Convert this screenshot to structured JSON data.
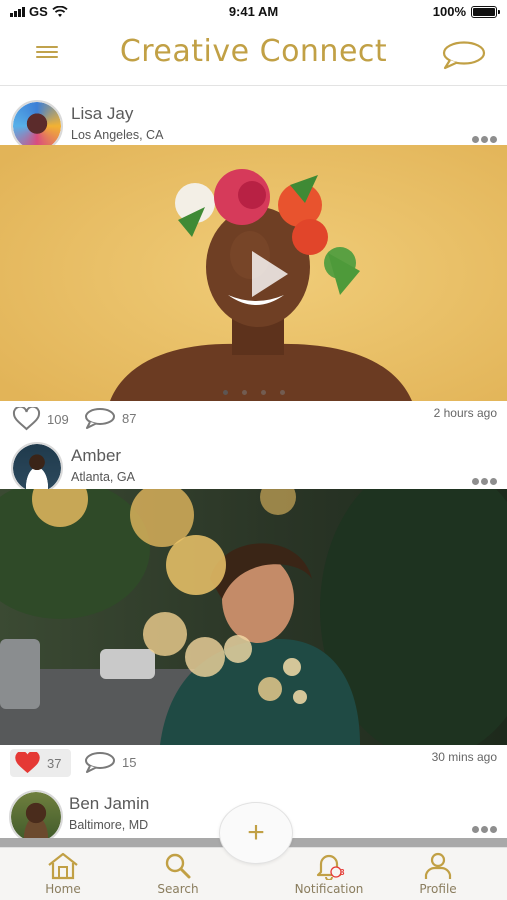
{
  "status_bar": {
    "carrier": "GS",
    "time": "9:41 AM",
    "battery": "100%"
  },
  "header": {
    "title": "Creative Connect",
    "menu_icon": "hamburger-icon",
    "chat_icon": "chat-bubble-icon"
  },
  "posts": [
    {
      "name": "Lisa Jay",
      "location": "Los Angeles, CA",
      "likes": "109",
      "comments": "87",
      "time": "2 hours ago",
      "liked": false,
      "has_video": true
    },
    {
      "name": "Amber",
      "location": "Atlanta, GA",
      "likes": "37",
      "comments": "15",
      "time": "30 mins ago",
      "liked": true,
      "has_video": false
    },
    {
      "name": "Ben Jamin",
      "location": "Baltimore, MD"
    }
  ],
  "tab_bar": {
    "tabs": [
      {
        "label": "Home",
        "icon": "home-icon"
      },
      {
        "label": "Search",
        "icon": "search-icon"
      },
      {
        "label": "Notification",
        "icon": "bell-icon",
        "badge": "3"
      },
      {
        "label": "Profile",
        "icon": "user-icon"
      }
    ],
    "fab_label": "+"
  },
  "colors": {
    "accent": "#c1a045",
    "like_red": "#e53935",
    "text": "#4a4a4a"
  }
}
